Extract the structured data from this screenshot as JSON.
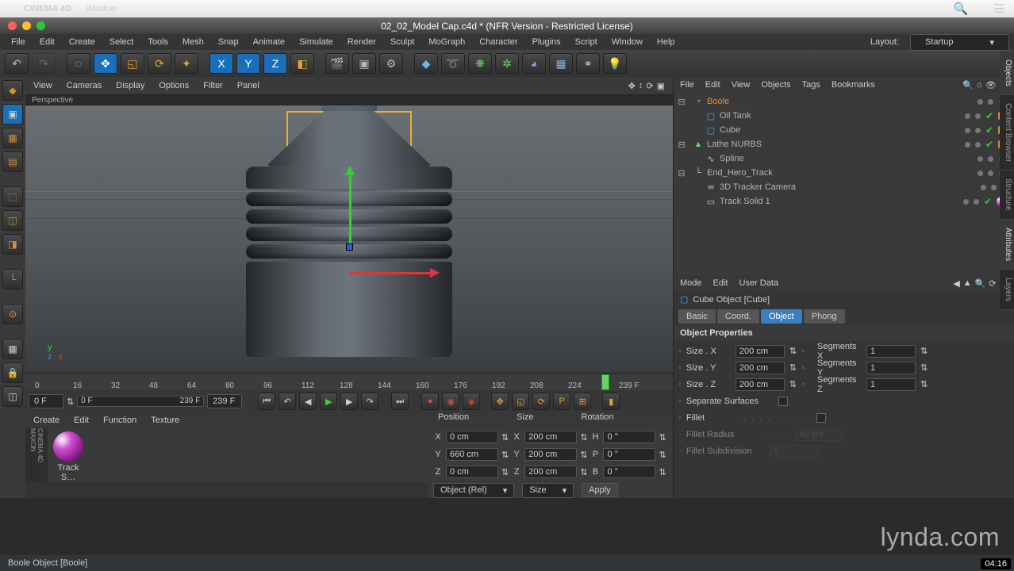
{
  "mac_menu": {
    "app": "CINEMA 4D",
    "window": "Window"
  },
  "window_title": "02_02_Model Cap.c4d * (NFR Version - Restricted License)",
  "main_menu": [
    "File",
    "Edit",
    "Create",
    "Select",
    "Tools",
    "Mesh",
    "Snap",
    "Animate",
    "Simulate",
    "Render",
    "Sculpt",
    "MoGraph",
    "Character",
    "Plugins",
    "Script",
    "Window",
    "Help"
  ],
  "layout": {
    "label": "Layout:",
    "value": "Startup"
  },
  "view_menu": [
    "View",
    "Cameras",
    "Display",
    "Options",
    "Filter",
    "Panel"
  ],
  "viewport_label": "Perspective",
  "timeline": {
    "ticks": [
      "0",
      "16",
      "32",
      "48",
      "64",
      "80",
      "96",
      "112",
      "128",
      "144",
      "160",
      "176",
      "192",
      "208",
      "224"
    ],
    "end_label": "239 F",
    "cur": "0 F",
    "slider_start": "0 F",
    "slider_end": "239 F",
    "range_end": "239 F"
  },
  "mat_menu": [
    "Create",
    "Edit",
    "Function",
    "Texture"
  ],
  "mat_item": "Track S…",
  "coord": {
    "heads": [
      "Position",
      "Size",
      "Rotation"
    ],
    "rows": [
      {
        "a": "X",
        "p": "0 cm",
        "sa": "X",
        "s": "200 cm",
        "ra": "H",
        "r": "0 °"
      },
      {
        "a": "Y",
        "p": "660 cm",
        "sa": "Y",
        "s": "200 cm",
        "ra": "P",
        "r": "0 °"
      },
      {
        "a": "Z",
        "p": "0 cm",
        "sa": "Z",
        "s": "200 cm",
        "ra": "B",
        "r": "0 °"
      }
    ],
    "mode": "Object (Rel)",
    "scale": "Size",
    "apply": "Apply"
  },
  "obj_menu": [
    "File",
    "Edit",
    "View",
    "Objects",
    "Tags",
    "Bookmarks"
  ],
  "tree": [
    {
      "d": 0,
      "exp": "⊟",
      "ico": "◔",
      "cls": "icn-lathe",
      "name": "Boole",
      "sel": true,
      "tags": [
        "dot",
        "chk"
      ]
    },
    {
      "d": 1,
      "exp": "",
      "ico": "▢",
      "cls": "icn-cube",
      "name": "Oil Tank",
      "tags": [
        "dot",
        "chk",
        "o"
      ]
    },
    {
      "d": 1,
      "exp": "",
      "ico": "▢",
      "cls": "icn-cube",
      "name": "Cube",
      "tags": [
        "dot",
        "chk",
        "o"
      ]
    },
    {
      "d": 0,
      "exp": "⊟",
      "ico": "▲",
      "cls": "icn-lathe",
      "name": "Lathe NURBS",
      "tags": [
        "dot",
        "chk",
        "o"
      ]
    },
    {
      "d": 1,
      "exp": "",
      "ico": "∿",
      "cls": "icn-spl",
      "name": "Spline",
      "tags": [
        "dot",
        "chk"
      ]
    },
    {
      "d": 0,
      "exp": "⊟",
      "ico": "└",
      "cls": "icn-null",
      "name": "End_Hero_Track",
      "tags": [
        "dot",
        "chk"
      ]
    },
    {
      "d": 1,
      "exp": "",
      "ico": "∞",
      "cls": "icn-cam",
      "name": "3D Tracker Camera",
      "tags": [
        "dot",
        "cross"
      ]
    },
    {
      "d": 1,
      "exp": "",
      "ico": "▭",
      "cls": "icn-sol",
      "name": "Track Solid 1",
      "tags": [
        "dot",
        "chk",
        "p"
      ]
    }
  ],
  "attr_menu": [
    "Mode",
    "Edit",
    "User Data"
  ],
  "attr_title": "Cube Object [Cube]",
  "attr_tabs": [
    "Basic",
    "Coord.",
    "Object",
    "Phong"
  ],
  "attr_section": "Object Properties",
  "props": [
    {
      "l": "Size . X",
      "v": "200 cm",
      "sl": "Segments X",
      "sv": "1"
    },
    {
      "l": "Size . Y",
      "v": "200 cm",
      "sl": "Segments Y",
      "sv": "1"
    },
    {
      "l": "Size . Z",
      "v": "200 cm",
      "sl": "Segments Z",
      "sv": "1"
    }
  ],
  "sep_surf": "Separate Surfaces",
  "fillet": "Fillet",
  "fillet_r": {
    "l": "Fillet Radius",
    "v": "40 cm"
  },
  "fillet_s": {
    "l": "Fillet Subdivision",
    "v": "5"
  },
  "status": "Boole Object [Boole]",
  "watermark": "lynda.com",
  "video_time": "04:16",
  "right_tabs": [
    "Objects",
    "Content Browser",
    "Structure",
    "Attributes",
    "Layers"
  ]
}
